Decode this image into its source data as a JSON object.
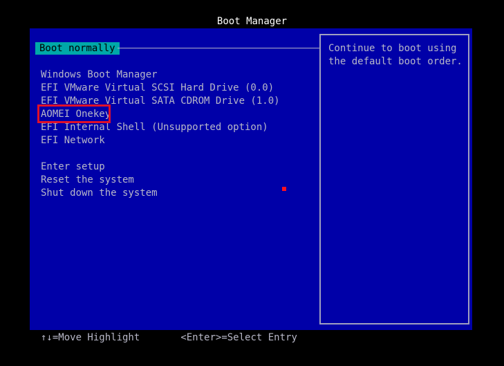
{
  "title": "Boot Manager",
  "selected": "Boot normally",
  "boot_entries": [
    "Windows Boot Manager",
    "EFI VMware Virtual SCSI Hard Drive (0.0)",
    "EFI VMware Virtual SATA CDROM Drive (1.0)",
    "AOMEI Onekey",
    "EFI Internal Shell (Unsupported option)",
    "EFI Network"
  ],
  "system_entries": [
    "Enter setup",
    "Reset the system",
    "Shut down the system"
  ],
  "help_text": "Continue to boot using\nthe default boot order.",
  "footer": {
    "move_hint": "↑↓=Move Highlight",
    "select_hint": "<Enter>=Select Entry"
  },
  "highlight_color": "#e0102a"
}
